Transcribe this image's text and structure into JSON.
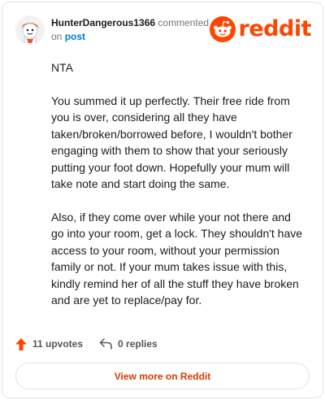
{
  "comment": {
    "username": "HunterDangerous1366",
    "action_text": "commented",
    "on_text": "on",
    "post_link": "post",
    "paragraphs": [
      "NTA",
      "You summed it up perfectly. Their free ride from you is over, considering all they have taken/broken/borrowed before, I wouldn't bother engaging with them to show that your seriously putting your foot down. Hopefully your mum will take note and start doing the same.",
      "Also, if they come over while your not there and go into your room, get a lock. They shouldn't have access to your room, without your permission family or not. If your mum takes issue with this, kindly remind her of all the stuff they have broken and are yet to replace/pay for."
    ]
  },
  "brand": {
    "wordmark": "reddit",
    "color": "#ff4500"
  },
  "actions": {
    "upvotes": "11 upvotes",
    "replies": "0 replies"
  },
  "view_more": "View more on Reddit"
}
